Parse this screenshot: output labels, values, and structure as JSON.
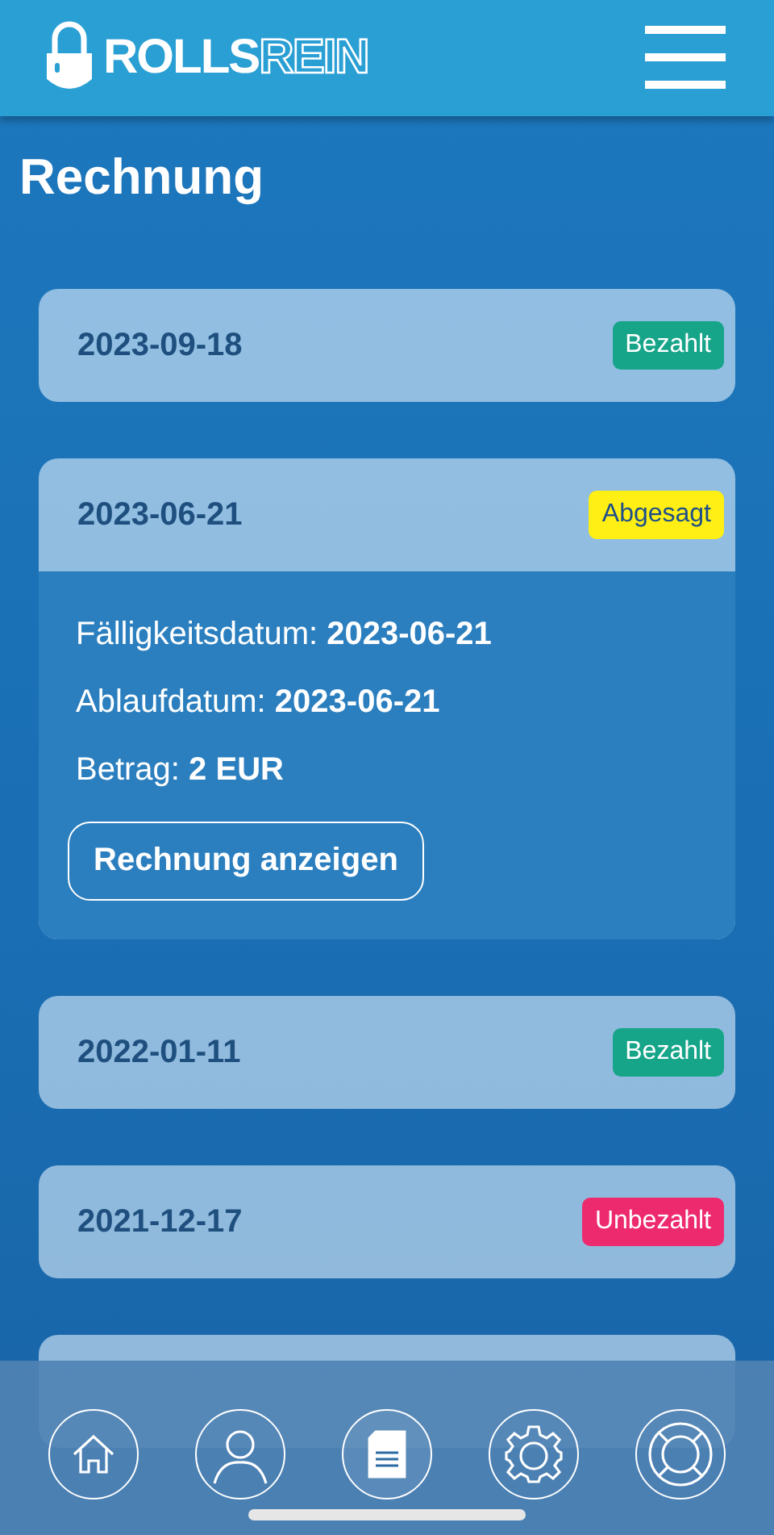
{
  "header": {
    "logo_bold": "ROLLS",
    "logo_outline": "REIN"
  },
  "title": "Rechnung",
  "invoices": [
    {
      "date": "2023-09-18",
      "status": "Bezahlt",
      "kind": "paid",
      "expanded": false
    },
    {
      "date": "2023-06-21",
      "status": "Abgesagt",
      "kind": "cancelled",
      "expanded": true,
      "details": [
        "Fälligkeitsdatum: **2023-06-21**",
        "Ablaufdatum: **2023-06-21**",
        "Betrag: **2 EUR**"
      ],
      "action": "Rechnung anzeigen"
    },
    {
      "date": "2022-01-11",
      "status": "Bezahlt",
      "kind": "paid",
      "expanded": false
    },
    {
      "date": "2021-12-17",
      "status": "Unbezahlt",
      "kind": "unpaid",
      "expanded": false
    }
  ],
  "nav": [
    {
      "kind": "home",
      "selected": false
    },
    {
      "kind": "profile",
      "selected": false
    },
    {
      "kind": "documents",
      "selected": true
    },
    {
      "kind": "settings",
      "selected": false
    },
    {
      "kind": "support",
      "selected": false
    }
  ]
}
